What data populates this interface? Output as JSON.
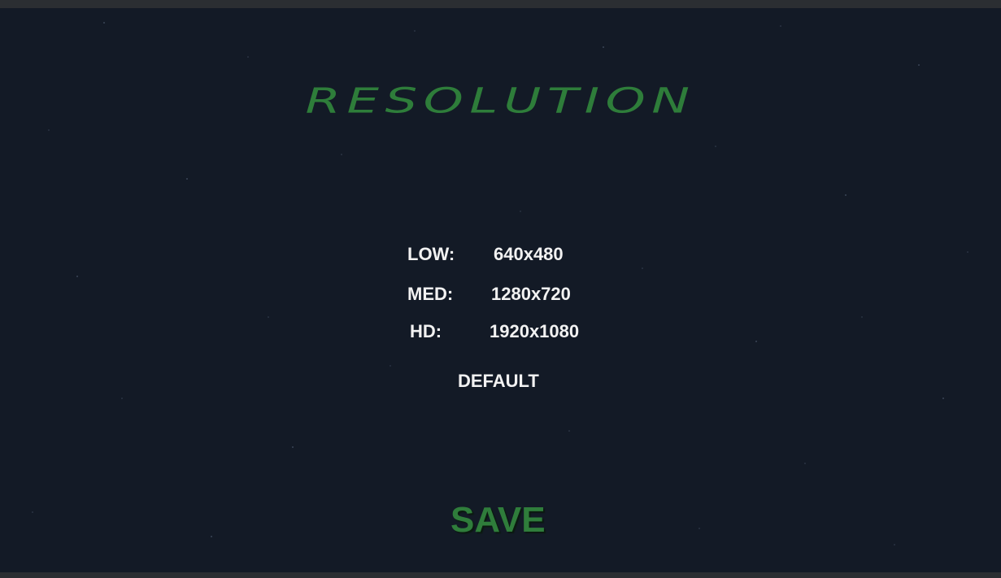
{
  "screen": {
    "title": "RESOLUTION"
  },
  "options": [
    {
      "label": "LOW:",
      "value": "640x480"
    },
    {
      "label": "MED:",
      "value": "1280x720"
    },
    {
      "label": "HD:",
      "value": "1920x1080"
    }
  ],
  "buttons": {
    "default_label": "DEFAULT",
    "save_label": "SAVE"
  },
  "colors": {
    "background": "#131a26",
    "accent_green": "#2e7d3a",
    "text": "#f2f2f2"
  }
}
